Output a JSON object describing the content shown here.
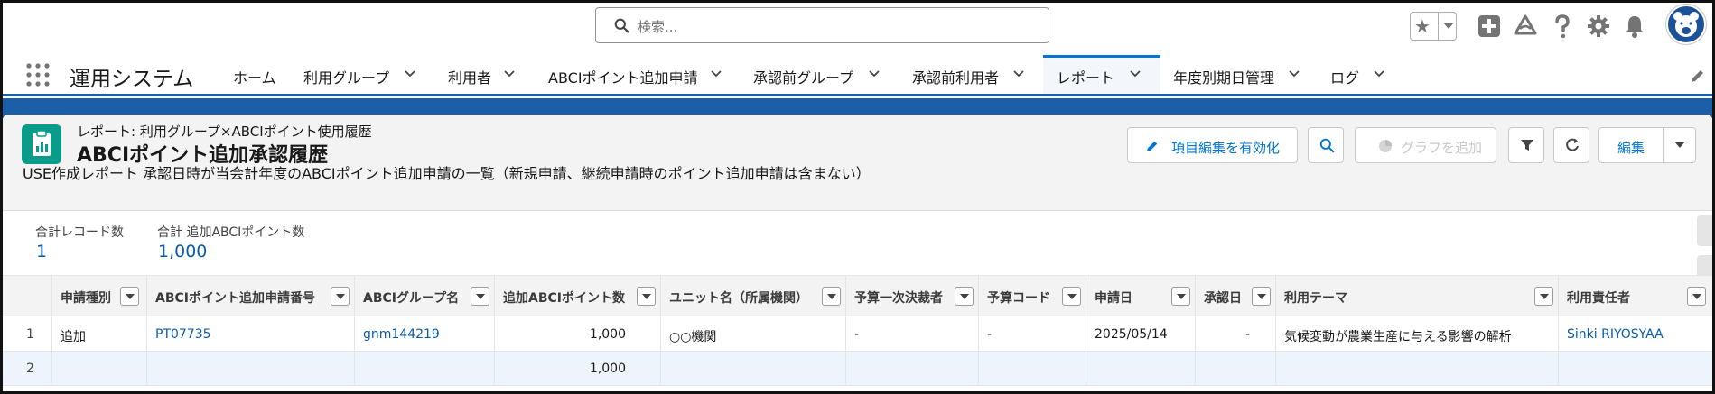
{
  "header": {
    "search_placeholder": "検索...",
    "icons": [
      "star-icon",
      "add-icon",
      "trailhead-icon",
      "help-icon",
      "setup-gear-icon",
      "notifications-bell-icon",
      "avatar-icon"
    ]
  },
  "nav": {
    "app_name": "運用システム",
    "items": [
      {
        "label": "ホーム",
        "has_menu": false
      },
      {
        "label": "利用グループ",
        "has_menu": true
      },
      {
        "label": "利用者",
        "has_menu": true
      },
      {
        "label": "ABCIポイント追加申請",
        "has_menu": true
      },
      {
        "label": "承認前グループ",
        "has_menu": true
      },
      {
        "label": "承認前利用者",
        "has_menu": true
      },
      {
        "label": "レポート",
        "has_menu": true,
        "active": true
      },
      {
        "label": "年度別期日管理",
        "has_menu": true
      },
      {
        "label": "ログ",
        "has_menu": true
      }
    ]
  },
  "report": {
    "breadcrumb": "レポート: 利用グループ×ABCIポイント使用履歴",
    "title": "ABCIポイント追加承認履歴",
    "description": "USE作成レポート 承認日時が当会計年度のABCIポイント追加申請の一覧（新規申請、継続申請時のポイント追加申請は含まない）",
    "buttons": {
      "enable_edit": "項目編集を有効化",
      "add_chart": "グラフを追加",
      "edit": "編集"
    }
  },
  "summary": {
    "record_count_label": "合計レコード数",
    "record_count": "1",
    "points_label": "合計 追加ABCIポイント数",
    "points_total": "1,000"
  },
  "table": {
    "columns": [
      "申請種別",
      "ABCIポイント追加申請番号",
      "ABCIグループ名",
      "追加ABCIポイント数",
      "ユニット名（所属機関）",
      "予算一次決裁者",
      "予算コード",
      "申請日",
      "承認日",
      "利用テーマ",
      "利用責任者"
    ],
    "rows": [
      {
        "num": "1",
        "type": "追加",
        "request_no": "PT07735",
        "group": "gnm144219",
        "points": "1,000",
        "unit": "○○機関",
        "approver": "-",
        "budget_code": "-",
        "applied": "2025/05/14",
        "approved": "-",
        "theme": "気候変動が農業生産に与える影響の解析",
        "owner": "Sinki RIYOSYAA"
      },
      {
        "num": "2",
        "type": "",
        "request_no": "",
        "group": "",
        "points": "1,000",
        "unit": "",
        "approver": "",
        "budget_code": "",
        "applied": "",
        "approved": "",
        "theme": "",
        "owner": ""
      }
    ]
  },
  "colors": {
    "brand_blue": "#1c5ea8",
    "link": "#0b5cab",
    "report_icon": "#0b9b8a"
  }
}
